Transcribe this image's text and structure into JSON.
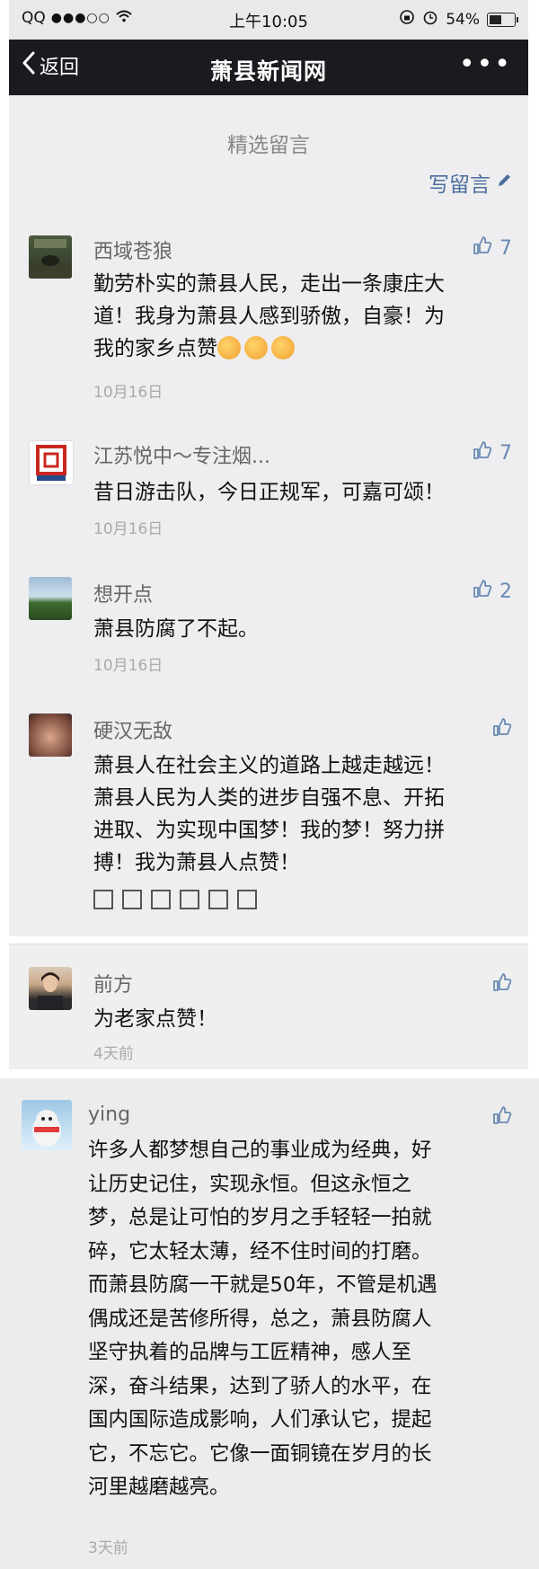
{
  "status_bar": {
    "carrier": "QQ",
    "signal": "●●●○○",
    "time": "上午10:05",
    "battery": "54%",
    "battery_level": 0.54
  },
  "nav": {
    "back_label": "返回",
    "title": "萧县新闻网",
    "more": "•••"
  },
  "section_title": "精选留言",
  "write_comment": "写留言",
  "comments": [
    {
      "name": "西域苍狼",
      "likes": "7",
      "lines": [
        "勤劳朴实的萧县人民，走出一条康庄大",
        "道！我身为萧县人感到骄傲，自豪！为",
        "我的家乡点赞"
      ],
      "date": "10月16日"
    },
    {
      "name": "江苏悦中～专注烟...",
      "likes": "7",
      "lines": [
        "昔日游击队，今日正规军，可嘉可颂！"
      ],
      "date": "10月16日"
    },
    {
      "name": "想开点",
      "likes": "2",
      "lines": [
        "萧县防腐了不起。"
      ],
      "date": "10月16日"
    },
    {
      "name": "硬汉无敌",
      "likes": "",
      "lines": [
        "萧县人在社会主义的道路上越走越远！",
        "萧县人民为人类的进步自强不息、开拓",
        "进取、为实现中国梦！我的梦！努力拼",
        "搏！我为萧县人点赞！"
      ],
      "date": ""
    },
    {
      "name": "前方",
      "likes": "",
      "lines": [
        "为老家点赞！"
      ],
      "date": "4天前"
    },
    {
      "name": "ying",
      "likes": "",
      "lines": [
        "许多人都梦想自己的事业成为经典，好",
        "让历史记住，实现永恒。但这永恒之",
        "梦，总是让可怕的岁月之手轻轻一拍就",
        "碎，它太轻太薄，经不住时间的打磨。",
        "而萧县防腐一干就是50年，不管是机遇",
        "偶成还是苦修所得，总之，萧县防腐人",
        "坚守执着的品牌与工匠精神，感人至",
        "深，奋斗结果，达到了骄人的水平，在",
        "国内国际造成影响，人们承认它，提起",
        "它，不忘它。它像一面铜镜在岁月的长",
        "河里越磨越亮。"
      ],
      "date": "3天前"
    }
  ],
  "colors": {
    "nav_bg": "#1a1b1f",
    "link_blue": "#4a6e9b",
    "like_blue": "#6a8ab3",
    "panel_bg": "#eeeef0"
  },
  "icons": [
    "back-chevron-icon",
    "more-icon",
    "pencil-icon",
    "thumbs-up-icon",
    "wifi-icon",
    "lock-rotation-icon",
    "alarm-icon",
    "battery-icon",
    "thumbs-up-emoji",
    "missing-glyph-box"
  ]
}
